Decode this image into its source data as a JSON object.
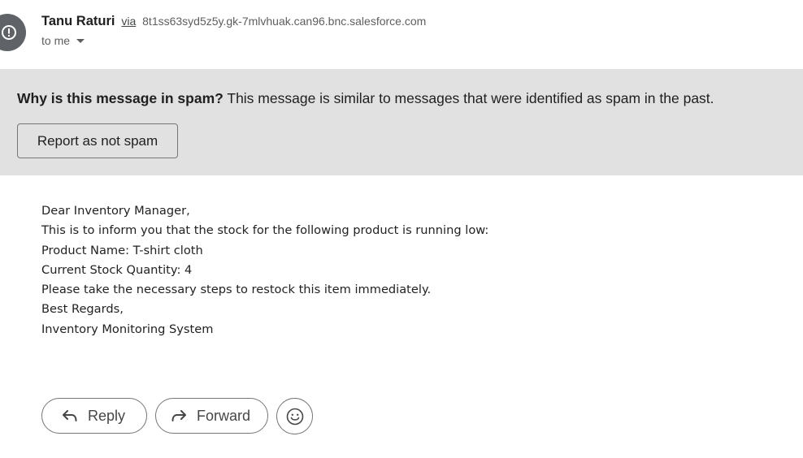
{
  "header": {
    "sender_name": "Tanu Raturi",
    "via_label": "via",
    "via_domain": "8t1ss63syd5z5y.gk-7mlvhuak.can96.bnc.salesforce.com",
    "recipient_label": "to me",
    "avatar_icon": "warning-icon",
    "avatar_color": "#5f6368"
  },
  "spam_banner": {
    "question": "Why is this message in spam?",
    "explanation": "This message is similar to messages that were identified as spam in the past.",
    "button_label": "Report as not spam",
    "background_color": "#e1e1e1"
  },
  "email_body": {
    "lines": [
      "Dear Inventory Manager,",
      "This is to inform you that the stock for the following product is running low:",
      "Product Name: T-shirt cloth",
      "Current Stock Quantity: 4",
      "Please take the necessary steps to restock this item immediately.",
      "Best Regards,",
      "Inventory Monitoring System"
    ]
  },
  "actions": {
    "reply_label": "Reply",
    "forward_label": "Forward",
    "reply_icon": "reply-arrow-icon",
    "forward_icon": "forward-arrow-icon",
    "emoji_icon": "smiley-icon"
  }
}
